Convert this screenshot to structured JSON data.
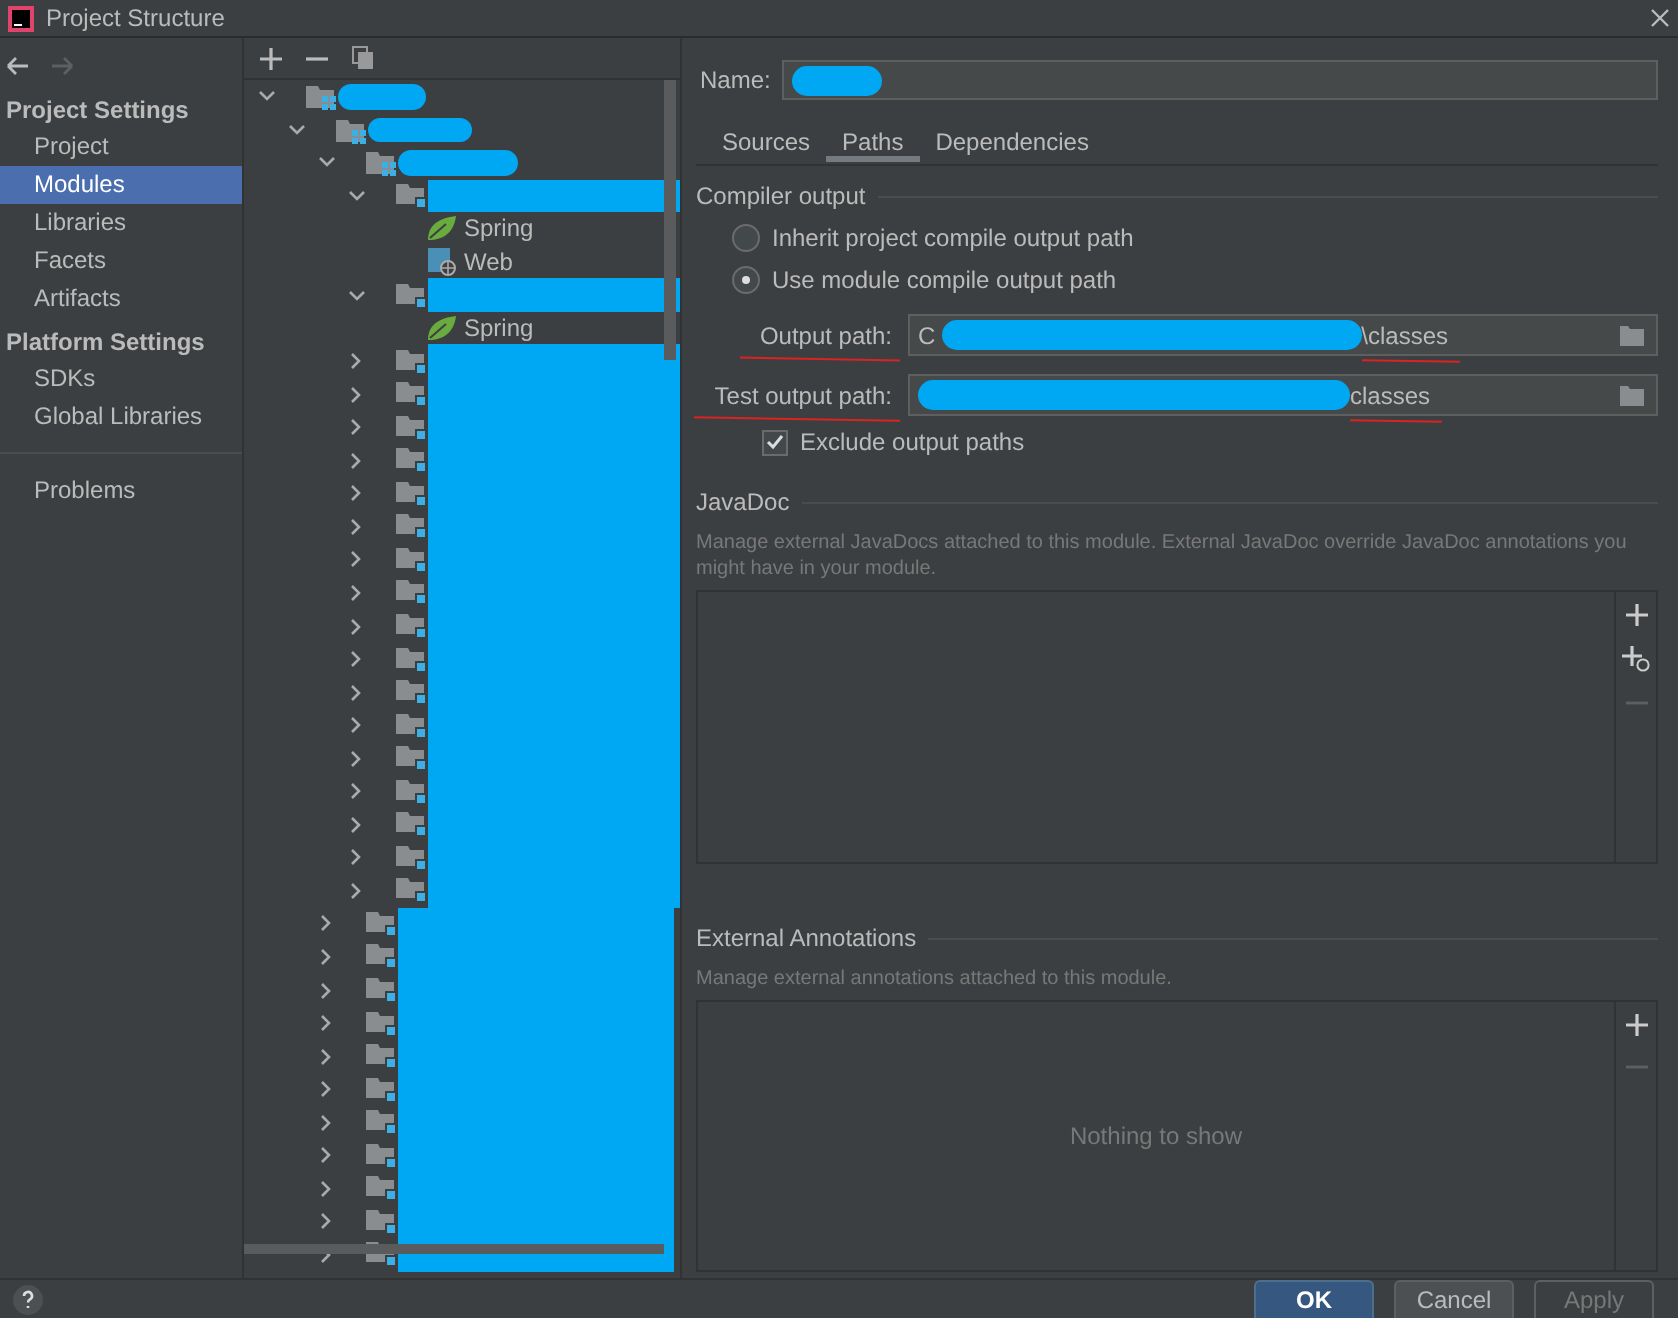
{
  "window": {
    "title": "Project Structure"
  },
  "sidebar": {
    "sections": [
      {
        "heading": "Project Settings",
        "items": [
          {
            "label": "Project",
            "selected": false
          },
          {
            "label": "Modules",
            "selected": true
          },
          {
            "label": "Libraries",
            "selected": false
          },
          {
            "label": "Facets",
            "selected": false
          },
          {
            "label": "Artifacts",
            "selected": false
          }
        ]
      },
      {
        "heading": "Platform Settings",
        "items": [
          {
            "label": "SDKs",
            "selected": false
          },
          {
            "label": "Global Libraries",
            "selected": false
          }
        ]
      },
      {
        "items": [
          {
            "label": "Problems",
            "selected": false
          }
        ]
      }
    ]
  },
  "tree": {
    "items": [
      {
        "kind": "group",
        "expanded": true,
        "redacted": true,
        "children": [
          {
            "kind": "group",
            "expanded": true,
            "redacted": true,
            "children": [
              {
                "kind": "group",
                "expanded": true,
                "redacted": true,
                "children": [
                  {
                    "kind": "module",
                    "expanded": true,
                    "redacted": true,
                    "children": [
                      {
                        "kind": "spring",
                        "label": "Spring"
                      },
                      {
                        "kind": "web",
                        "label": "Web"
                      }
                    ]
                  },
                  {
                    "kind": "module",
                    "expanded": true,
                    "redacted": true,
                    "children": [
                      {
                        "kind": "spring",
                        "label": "Spring"
                      }
                    ]
                  },
                  {
                    "kind": "module",
                    "expanded": false,
                    "redacted": true
                  },
                  {
                    "kind": "module",
                    "expanded": false,
                    "redacted": true
                  },
                  {
                    "kind": "module",
                    "expanded": false,
                    "redacted": true
                  },
                  {
                    "kind": "module",
                    "expanded": false,
                    "redacted": true
                  },
                  {
                    "kind": "module",
                    "expanded": false,
                    "redacted": true
                  },
                  {
                    "kind": "module",
                    "expanded": false,
                    "redacted": true
                  },
                  {
                    "kind": "module",
                    "expanded": false,
                    "redacted": true
                  },
                  {
                    "kind": "module",
                    "expanded": false,
                    "redacted": true
                  },
                  {
                    "kind": "module",
                    "expanded": false,
                    "redacted": true
                  },
                  {
                    "kind": "module",
                    "expanded": false,
                    "redacted": true
                  },
                  {
                    "kind": "module",
                    "expanded": false,
                    "redacted": true
                  },
                  {
                    "kind": "module",
                    "expanded": false,
                    "redacted": true
                  },
                  {
                    "kind": "module",
                    "expanded": false,
                    "redacted": true
                  },
                  {
                    "kind": "module",
                    "expanded": false,
                    "redacted": true
                  },
                  {
                    "kind": "module",
                    "expanded": false,
                    "redacted": true
                  },
                  {
                    "kind": "module",
                    "expanded": false,
                    "redacted": true
                  },
                  {
                    "kind": "module",
                    "expanded": false,
                    "redacted": true
                  }
                ]
              },
              {
                "kind": "module",
                "expanded": false,
                "redacted": true
              },
              {
                "kind": "module",
                "expanded": false,
                "redacted": true
              },
              {
                "kind": "module",
                "expanded": false,
                "redacted": true
              },
              {
                "kind": "module",
                "expanded": false,
                "redacted": true
              },
              {
                "kind": "module",
                "expanded": false,
                "redacted": true
              },
              {
                "kind": "module",
                "expanded": false,
                "redacted": true
              },
              {
                "kind": "module",
                "expanded": false,
                "redacted": true
              },
              {
                "kind": "module",
                "expanded": false,
                "redacted": true
              },
              {
                "kind": "module",
                "expanded": false,
                "redacted": true
              },
              {
                "kind": "module",
                "expanded": false,
                "redacted": true
              },
              {
                "kind": "module",
                "expanded": false,
                "redacted": true
              }
            ]
          }
        ]
      }
    ]
  },
  "module": {
    "name": {
      "label": "Name:",
      "redacted": true
    },
    "tabs": [
      {
        "label": "Sources",
        "selected": false
      },
      {
        "label": "Paths",
        "selected": true
      },
      {
        "label": "Dependencies",
        "selected": false
      }
    ],
    "compiler_output": {
      "heading": "Compiler output",
      "options": [
        {
          "label": "Inherit project compile output path",
          "selected": false
        },
        {
          "label": "Use module compile output path",
          "selected": true
        }
      ],
      "fields": [
        {
          "label": "Output path:",
          "value_start": "C",
          "value_end": "\\classes",
          "redacted": true,
          "annotated": true
        },
        {
          "label": "Test output path:",
          "value_end": "classes",
          "redacted": true,
          "annotated": true
        }
      ],
      "exclude": {
        "label": "Exclude output paths",
        "checked": true
      }
    },
    "javadoc": {
      "heading": "JavaDoc",
      "description": "Manage external JavaDocs attached to this module. External JavaDoc override JavaDoc annotations you might have in your module.",
      "tools": [
        {
          "kind": "add",
          "disabled": false
        },
        {
          "kind": "add-url",
          "disabled": false
        },
        {
          "kind": "remove",
          "disabled": true
        }
      ]
    },
    "annotations": {
      "heading": "External Annotations",
      "description": "Manage external annotations attached to this module.",
      "empty_text": "Nothing to show",
      "tools": [
        {
          "kind": "add",
          "disabled": false
        },
        {
          "kind": "remove",
          "disabled": true
        }
      ]
    }
  },
  "buttons": [
    {
      "label": "OK",
      "default": true,
      "disabled": false
    },
    {
      "label": "Cancel",
      "default": false,
      "disabled": false
    },
    {
      "label": "Apply",
      "default": false,
      "disabled": true
    }
  ]
}
